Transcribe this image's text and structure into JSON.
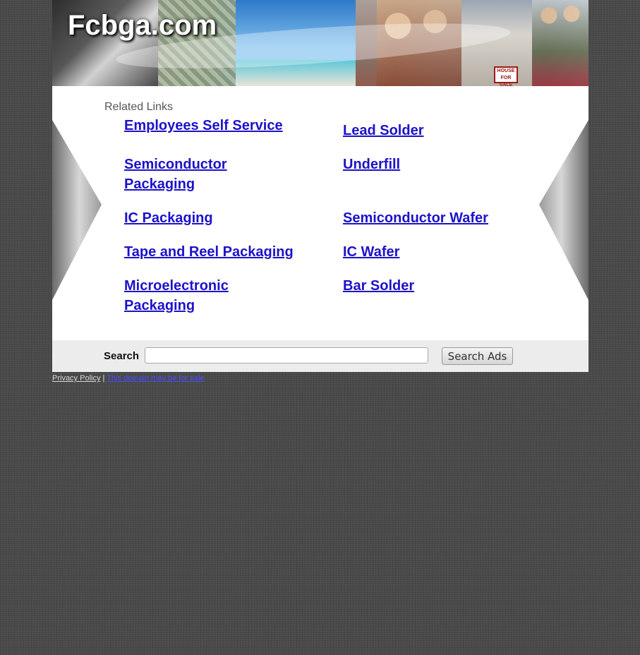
{
  "site": {
    "title": "Fcbga.com"
  },
  "header": {
    "sale_sign": "HOUSE FOR SALE"
  },
  "related": {
    "title": "Related Links",
    "links": [
      "Employees Self Service",
      "Lead Solder",
      "Semiconductor Packaging",
      "Underfill",
      "IC Packaging",
      "Semiconductor Wafer",
      "Tape and Reel Packaging",
      "IC Wafer",
      "Microelectronic Packaging",
      "Bar Solder"
    ]
  },
  "search": {
    "label": "Search",
    "value": "",
    "placeholder": "",
    "button": "Search Ads"
  },
  "footer": {
    "privacy": "Privacy Policy",
    "separator": "|",
    "for_sale": "This domain may be for sale"
  },
  "colors": {
    "link": "#1d12c9",
    "page_bg": "#4a4a4a",
    "search_bar_bg": "#ececec"
  }
}
